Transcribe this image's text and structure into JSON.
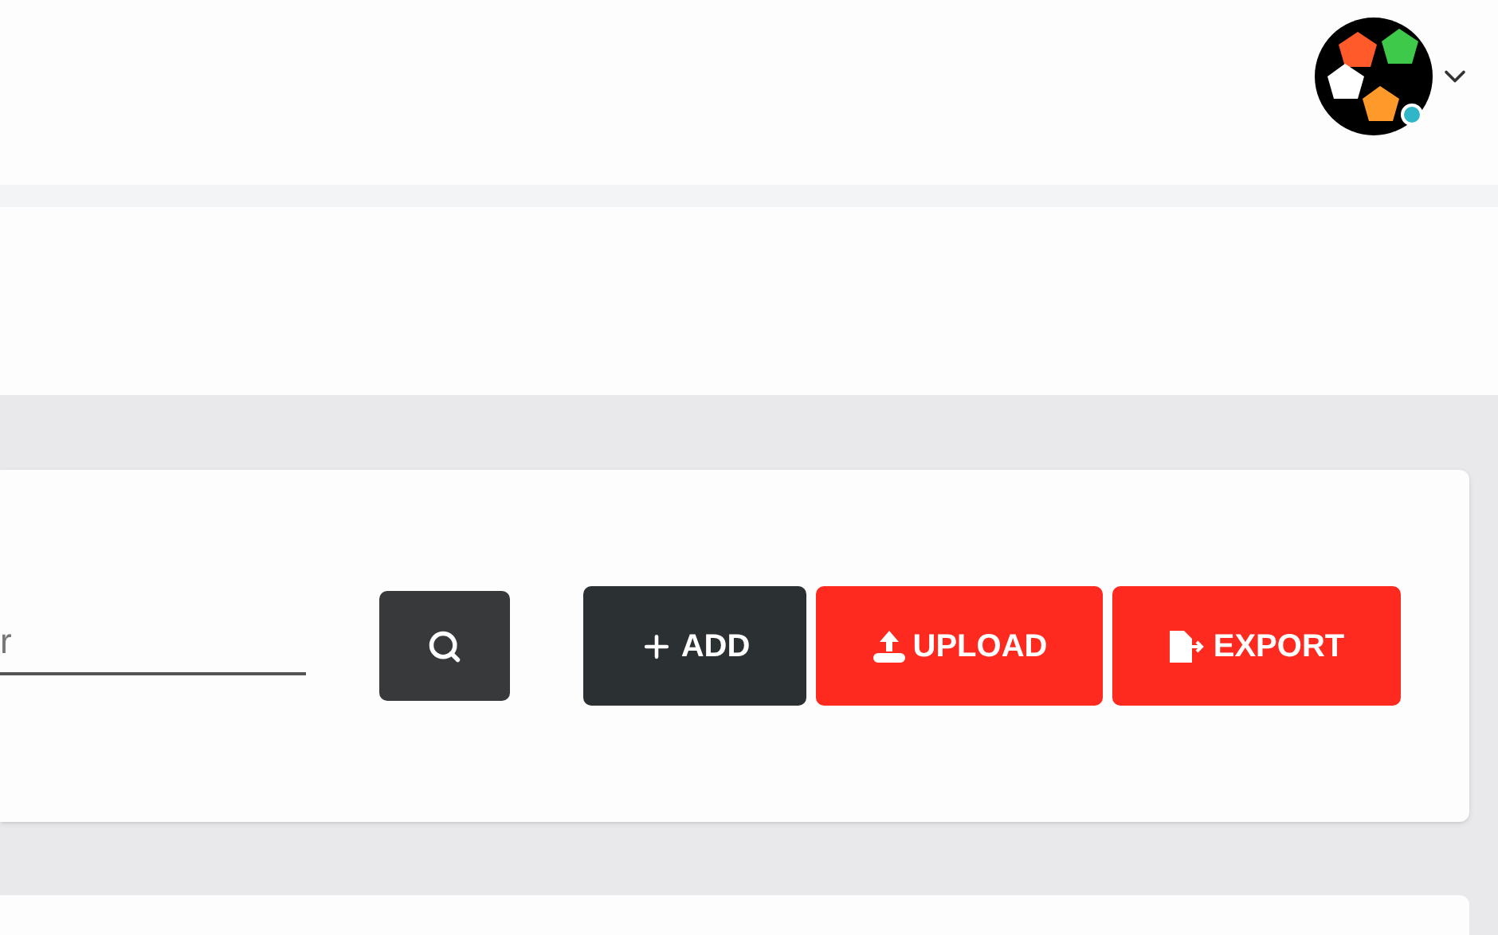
{
  "header": {
    "user_menu": {
      "online": true
    }
  },
  "toolbar": {
    "search": {
      "placeholder": "r"
    },
    "buttons": [
      {
        "kind": "add",
        "label": "ADD"
      },
      {
        "kind": "upload",
        "label": "UPLOAD"
      },
      {
        "kind": "export",
        "label": "EXPORT"
      }
    ]
  }
}
